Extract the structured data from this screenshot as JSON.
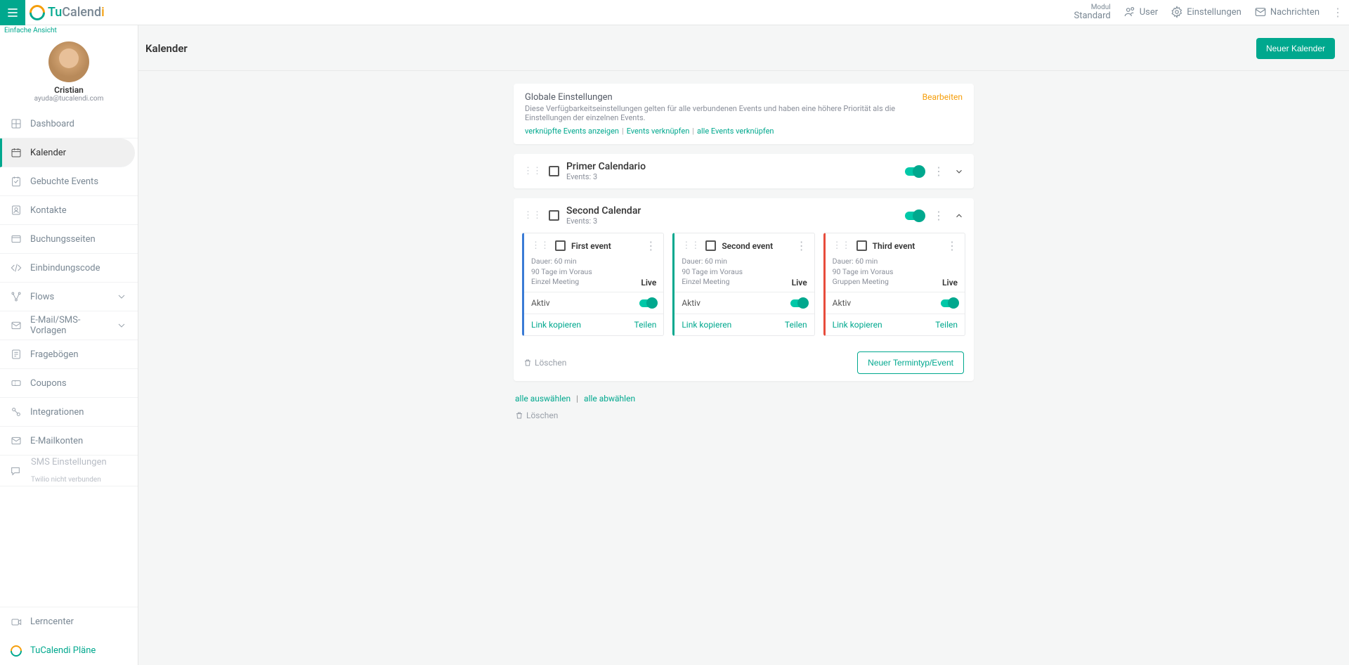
{
  "header": {
    "modul_label": "Modul",
    "modul_value": "Standard",
    "user": "User",
    "settings": "Einstellungen",
    "messages": "Nachrichten"
  },
  "logo": {
    "p1": "Tu",
    "p2": "Calend",
    "p3": "i"
  },
  "sidebar": {
    "simple_view": "Einfache Ansicht",
    "profile_name": "Cristian",
    "profile_email": "ayuda@tucalendi.com",
    "items": {
      "dashboard": "Dashboard",
      "calendar": "Kalender",
      "booked": "Gebuchte Events",
      "contacts": "Kontakte",
      "booking_pages": "Buchungsseiten",
      "embed": "Einbindungscode",
      "flows": "Flows",
      "templates": "E-Mail/SMS-Vorlagen",
      "surveys": "Fragebögen",
      "coupons": "Coupons",
      "integrations": "Integrationen",
      "mailaccounts": "E-Mailkonten",
      "sms": "SMS Einstellungen",
      "sms_sub": "Twilio nicht verbunden",
      "learn": "Lerncenter",
      "plans": "TuCalendi Pläne"
    }
  },
  "main": {
    "title": "Kalender",
    "new_calendar": "Neuer Kalender",
    "global": {
      "title": "Globale Einstellungen",
      "desc": "Diese Verfügbarkeitseinstellungen gelten für alle verbundenen Events und haben eine höhere Priorität als die Einstellungen der einzelnen Events.",
      "link1": "verknüpfte Events anzeigen",
      "link2": "Events verknüpfen",
      "link3": "alle Events verknüpfen",
      "edit": "Bearbeiten"
    },
    "calendars": [
      {
        "name": "Primer Calendario",
        "sub": "Events: 3"
      },
      {
        "name": "Second Calendar",
        "sub": "Events: 3"
      }
    ],
    "events": [
      {
        "name": "First event",
        "dur": "Dauer: 60 min",
        "adv": "90 Tage im Voraus",
        "type": "Einzel Meeting",
        "live": "Live",
        "active": "Aktiv",
        "copy": "Link kopieren",
        "share": "Teilen"
      },
      {
        "name": "Second event",
        "dur": "Dauer: 60 min",
        "adv": "90 Tage im Voraus",
        "type": "Einzel Meeting",
        "live": "Live",
        "active": "Aktiv",
        "copy": "Link kopieren",
        "share": "Teilen"
      },
      {
        "name": "Third event",
        "dur": "Dauer: 60 min",
        "adv": "90 Tage im Voraus",
        "type": "Gruppen Meeting",
        "live": "Live",
        "active": "Aktiv",
        "copy": "Link kopieren",
        "share": "Teilen"
      }
    ],
    "delete": "Löschen",
    "new_event": "Neuer Termintyp/Event",
    "select_all": "alle auswählen",
    "deselect_all": "alle abwählen"
  }
}
